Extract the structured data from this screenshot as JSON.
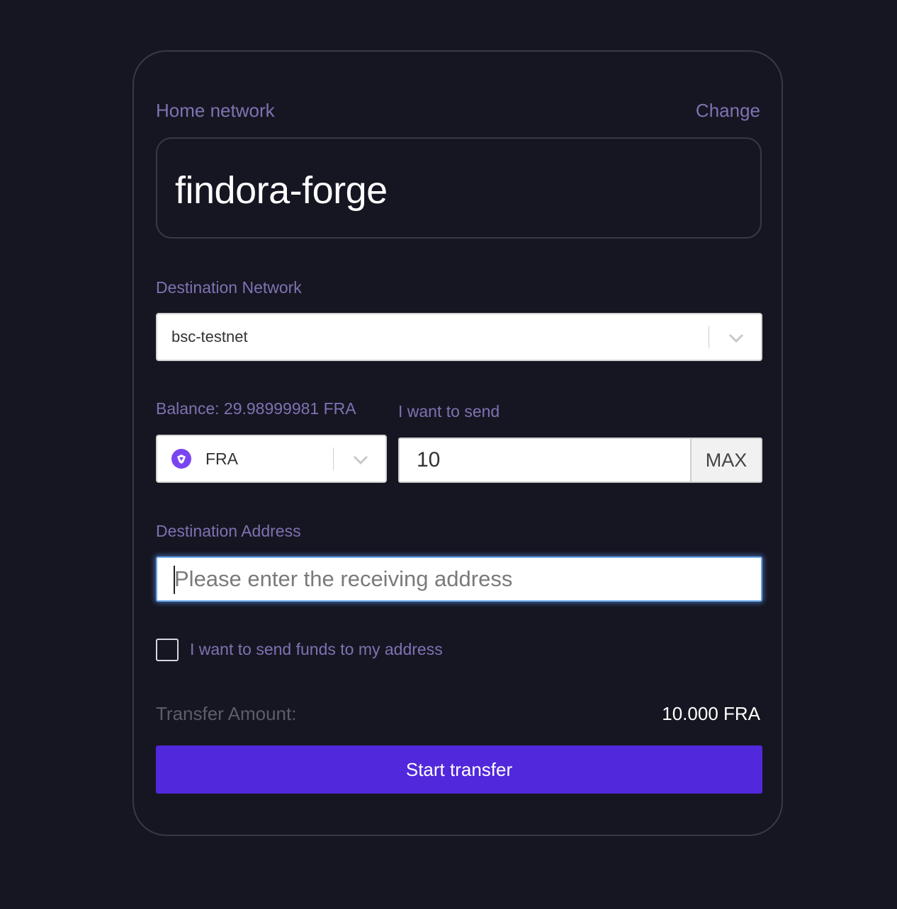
{
  "form": {
    "home_label": "Home network",
    "change_label": "Change",
    "home_network": "findora-forge",
    "destination_network_label": "Destination Network",
    "destination_network": "bsc-testnet",
    "balance_label": "Balance: 29.98999981 FRA",
    "send_label": "I want to send",
    "token": "FRA",
    "amount": "10",
    "max_label": "MAX",
    "address_label": "Destination Address",
    "address_placeholder": "Please enter the receiving address",
    "self_send_label": "I want to send funds to my address",
    "transfer_amount_label": "Transfer Amount:",
    "transfer_amount_value": "10.000 FRA",
    "start_button": "Start transfer"
  },
  "icons": {
    "token_icon": "fra-token-icon",
    "dropdown": "chevron-down-icon"
  },
  "colors": {
    "background": "#161622",
    "label": "#7e72b2",
    "accent": "#5128dc",
    "focus_ring": "#6aa6e8"
  }
}
